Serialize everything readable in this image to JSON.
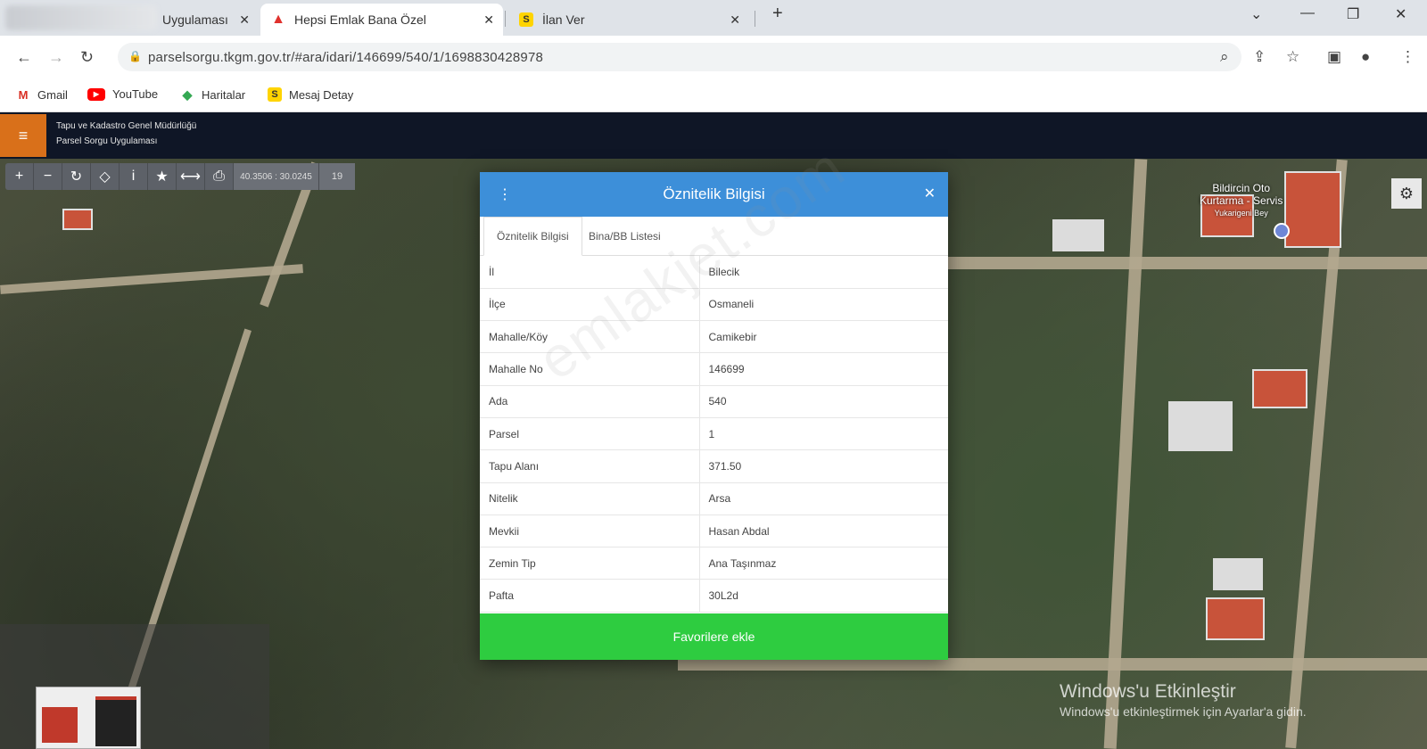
{
  "browser": {
    "tabs": [
      {
        "label": "Uygulaması",
        "icon": "blurred-favicon"
      },
      {
        "label": "Hepsi Emlak Bana Özel",
        "icon": "hepsiemlak-logo"
      },
      {
        "label": "İlan Ver",
        "icon": "sahibinden-logo"
      }
    ],
    "new_tab": "+",
    "url": "parselsorgu.tkgm.gov.tr/#ara/idari/146699/540/1/1698830428978",
    "bookmarks": [
      {
        "label": "Gmail",
        "icon": "gmail-icon"
      },
      {
        "label": "YouTube",
        "icon": "youtube-icon"
      },
      {
        "label": "Haritalar",
        "icon": "maps-icon"
      },
      {
        "label": "Mesaj Detay",
        "icon": "sahibinden-logo"
      }
    ]
  },
  "app": {
    "org_name": "Tapu ve Kadastro Genel Müdürlüğü",
    "app_name": "Parsel Sorgu Uygulaması"
  },
  "map_toolbar": {
    "coordinates": "40.3506 : 30.0245",
    "zoom": "19"
  },
  "map": {
    "poi_label_1": "Bildircin Oto",
    "poi_label_2": "Kurtarma - Servis",
    "poi_label_3": "Yukarigeni Bey"
  },
  "dialog": {
    "title": "Öznitelik Bilgisi",
    "tabs": [
      "Öznitelik Bilgisi",
      "Bina/BB Listesi"
    ],
    "rows": [
      {
        "key": "İl",
        "value": "Bilecik"
      },
      {
        "key": "İlçe",
        "value": "Osmaneli"
      },
      {
        "key": "Mahalle/Köy",
        "value": "Camikebir"
      },
      {
        "key": "Mahalle No",
        "value": "146699"
      },
      {
        "key": "Ada",
        "value": "540"
      },
      {
        "key": "Parsel",
        "value": "1"
      },
      {
        "key": "Tapu Alanı",
        "value": "371.50"
      },
      {
        "key": "Nitelik",
        "value": "Arsa"
      },
      {
        "key": "Mevkii",
        "value": "Hasan Abdal"
      },
      {
        "key": "Zemin Tip",
        "value": "Ana Taşınmaz"
      },
      {
        "key": "Pafta",
        "value": "30L2d"
      }
    ],
    "favorite_button": "Favorilere ekle"
  },
  "watermark": "emlakjet.com",
  "windows_activation": {
    "line1": "Windows'u Etkinleştir",
    "line2": "Windows'u etkinleştirmek için Ayarlar'a gidin."
  },
  "colors": {
    "dialog_header": "#3d8fd9",
    "favorite_button": "#2ecc40",
    "menu_button": "#d9701a",
    "app_header": "#0f1626"
  }
}
